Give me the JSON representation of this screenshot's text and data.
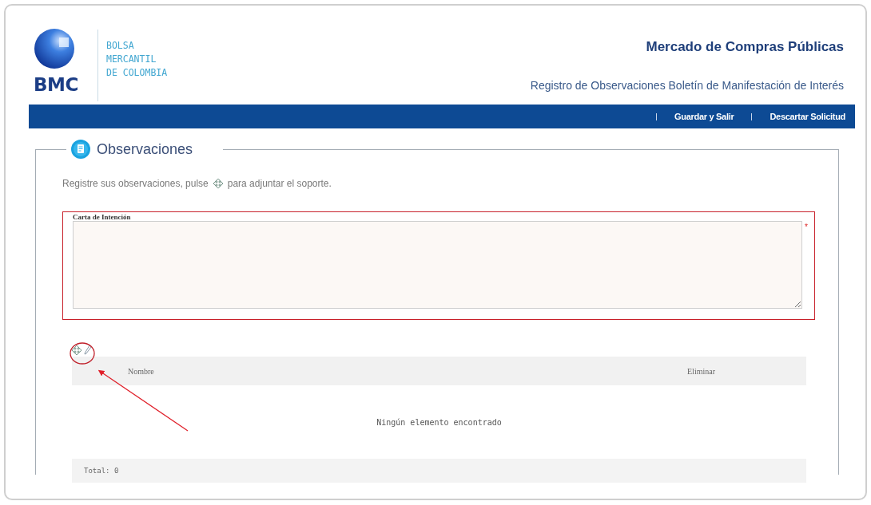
{
  "logo": {
    "mark": "BMC",
    "name_lines": [
      "BOLSA",
      "MERCANTIL",
      "DE COLOMBIA"
    ]
  },
  "header": {
    "title": "Mercado de Compras Públicas",
    "subtitle": "Registro de Observaciones Boletín de Manifestación de Interés"
  },
  "nav": {
    "links": [
      "Guardar y Salir",
      "Descartar Solicitud"
    ]
  },
  "section": {
    "title": "Observaciones",
    "instruction_before": "Registre sus observaciones, pulse",
    "instruction_after": "para adjuntar el soporte."
  },
  "field": {
    "label": "Carta de Intención",
    "required_mark": "*"
  },
  "table": {
    "columns": [
      "Nombre",
      "Eliminar"
    ],
    "empty_message": "Ningún elemento encontrado",
    "total": "Total: 0"
  }
}
